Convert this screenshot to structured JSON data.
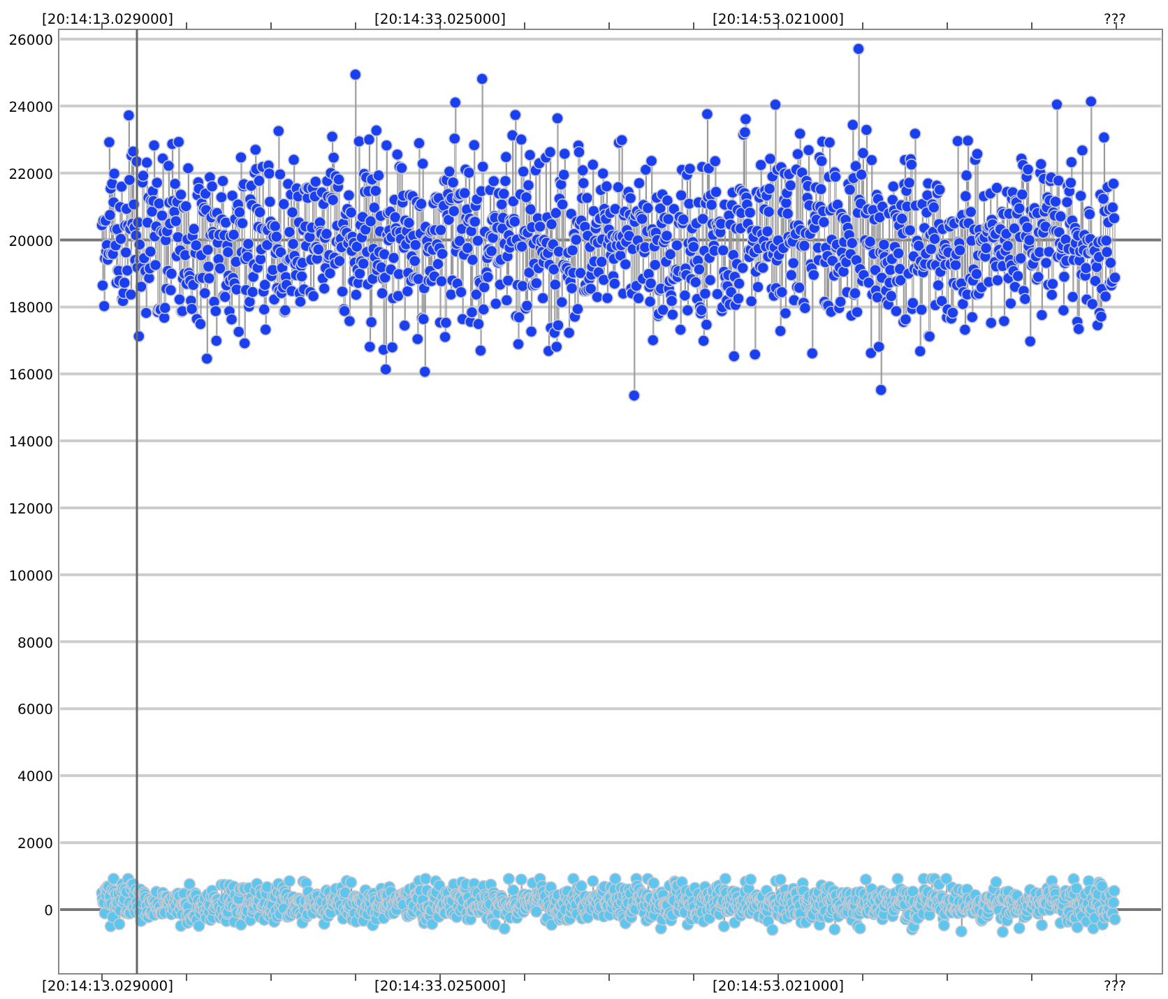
{
  "chart": {
    "y_axis_labels": [
      "26000",
      "24000",
      "22000",
      "20000",
      "18000",
      "16000",
      "14000",
      "12000",
      "10000",
      "8000",
      "6000",
      "4000",
      "2000",
      "0"
    ],
    "top_time_labels": [
      "[20:14:13.029000]",
      "[20:14:33.025000]",
      "[20:14:53.021000]",
      "???"
    ],
    "bottom_time_labels": [
      "[20:14:13.029000]",
      "[20:14:33.025000]",
      "[20:14:53.021000]",
      "???"
    ],
    "series": [
      {
        "color": "#1a3ff0"
      },
      {
        "color": "#5cc6ee"
      }
    ]
  }
}
